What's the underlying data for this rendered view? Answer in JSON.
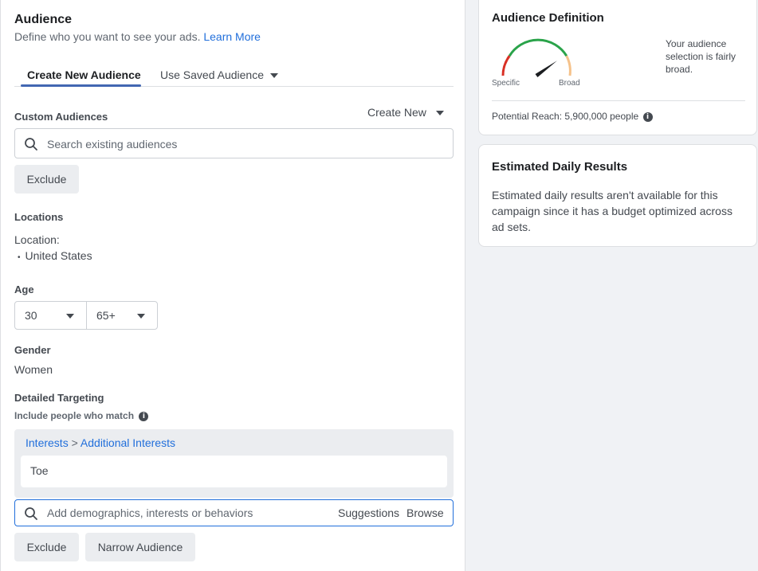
{
  "audience": {
    "title": "Audience",
    "subtitle": "Define who you want to see your ads.",
    "learn_more": "Learn More",
    "tabs": [
      {
        "label": "Create New Audience"
      },
      {
        "label": "Use Saved Audience"
      }
    ],
    "custom_audiences": {
      "label": "Custom Audiences",
      "create_new": "Create New",
      "search_placeholder": "Search existing audiences",
      "exclude_label": "Exclude"
    },
    "locations": {
      "label": "Locations",
      "location_label": "Location:",
      "items": [
        "United States"
      ]
    },
    "age": {
      "label": "Age",
      "min": "30",
      "max": "65+"
    },
    "gender": {
      "label": "Gender",
      "value": "Women"
    },
    "detailed_targeting": {
      "label": "Detailed Targeting",
      "include_label": "Include people who match",
      "breadcrumb_root": "Interests",
      "breadcrumb_sep": ">",
      "breadcrumb_child": "Additional Interests",
      "interests": [
        "Toe"
      ],
      "search_placeholder": "Add demographics, interests or behaviors",
      "suggestions": "Suggestions",
      "browse": "Browse",
      "exclude_label": "Exclude",
      "narrow_label": "Narrow Audience"
    }
  },
  "definition": {
    "title": "Audience Definition",
    "gauge_specific": "Specific",
    "gauge_broad": "Broad",
    "gauge_level": 0.8,
    "description": "Your audience selection is fairly broad.",
    "reach_label": "Potential Reach:",
    "reach_value": "5,900,000 people"
  },
  "daily": {
    "title": "Estimated Daily Results",
    "description": "Estimated daily results aren't available for this campaign since it has a budget optimized across ad sets."
  },
  "colors": {
    "accent": "#216fdb",
    "tab_underline": "#4267b2",
    "gauge_red": "#d93025",
    "gauge_green": "#2aa34a",
    "gauge_orange": "#f5c28b"
  }
}
